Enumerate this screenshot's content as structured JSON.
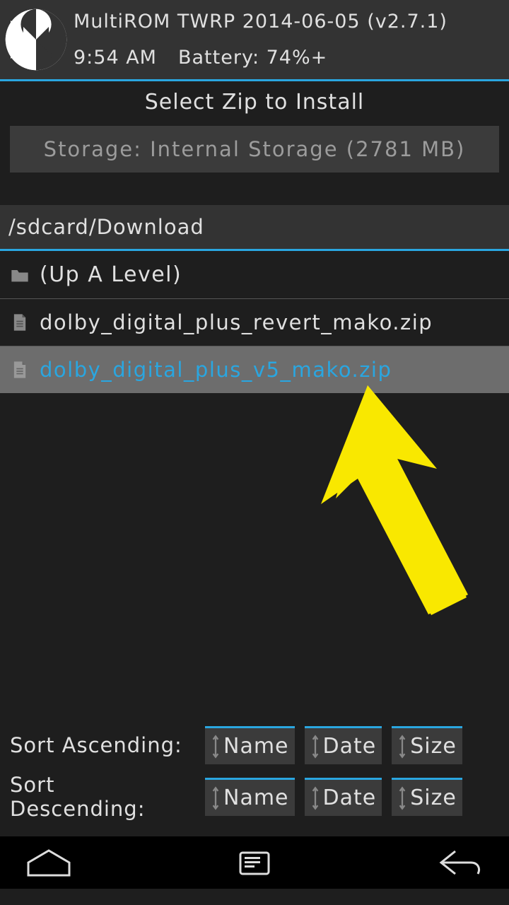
{
  "header": {
    "title": "MultiROM TWRP 2014-06-05 (v2.7.1)",
    "time": "9:54 AM",
    "battery": "Battery: 74%+"
  },
  "page": {
    "title": "Select Zip to Install",
    "storage_label": "Storage: Internal Storage (2781 MB)"
  },
  "path": "/sdcard/Download",
  "files": {
    "up_label": "(Up A Level)",
    "items": [
      {
        "name": "dolby_digital_plus_revert_mako.zip"
      },
      {
        "name": "dolby_digital_plus_v5_mako.zip"
      }
    ]
  },
  "sort": {
    "asc_label": "Sort Ascending:",
    "desc_label": "Sort Descending:",
    "name": "Name",
    "date": "Date",
    "size": "Size"
  },
  "colors": {
    "accent": "#2aa6e0",
    "arrow": "#f9e800"
  }
}
